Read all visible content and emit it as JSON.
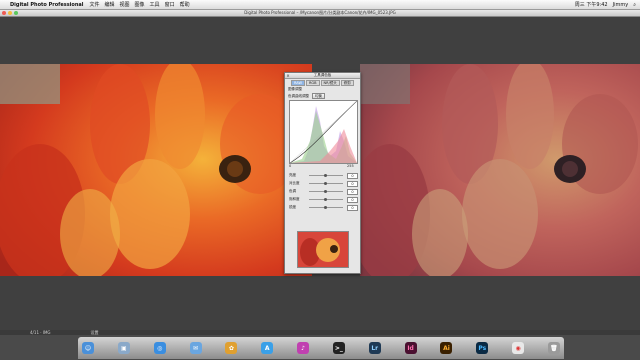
{
  "menubar": {
    "app_name": "Digital Photo Professional",
    "items": [
      "文件",
      "编辑",
      "视图",
      "图像",
      "工具",
      "窗口",
      "帮助"
    ],
    "clock": "周三 下午9:42",
    "user": "Jimmy"
  },
  "window": {
    "title": "Digital Photo Professional – /Mycanon图片/分类副本Canon/花卉/IMG_0523.JPG"
  },
  "palette": {
    "title": "工具调色板",
    "tabs": [
      "RAW",
      "RGB",
      "NR/镜头",
      "修剪"
    ],
    "section1": "图像调整",
    "section2": "色调曲线调整",
    "mode_btn": "均衡",
    "rows": [
      {
        "label": "亮度",
        "value": "0"
      },
      {
        "label": "对比度",
        "value": "0"
      },
      {
        "label": "色调",
        "value": "0"
      },
      {
        "label": "饱和度",
        "value": "0"
      },
      {
        "label": "锐度",
        "value": "0"
      }
    ],
    "level_low": "0",
    "level_high": "255"
  },
  "status": {
    "left": "4/11 · IMG",
    "mid": "设置"
  },
  "dock": [
    "Finder",
    "Preview",
    "Safari",
    "Mail",
    "Photos",
    "App Store",
    "iTunes",
    "Terminal",
    "Lr",
    "Id",
    "Ai",
    "Ps",
    "Chrome",
    "Trash"
  ]
}
